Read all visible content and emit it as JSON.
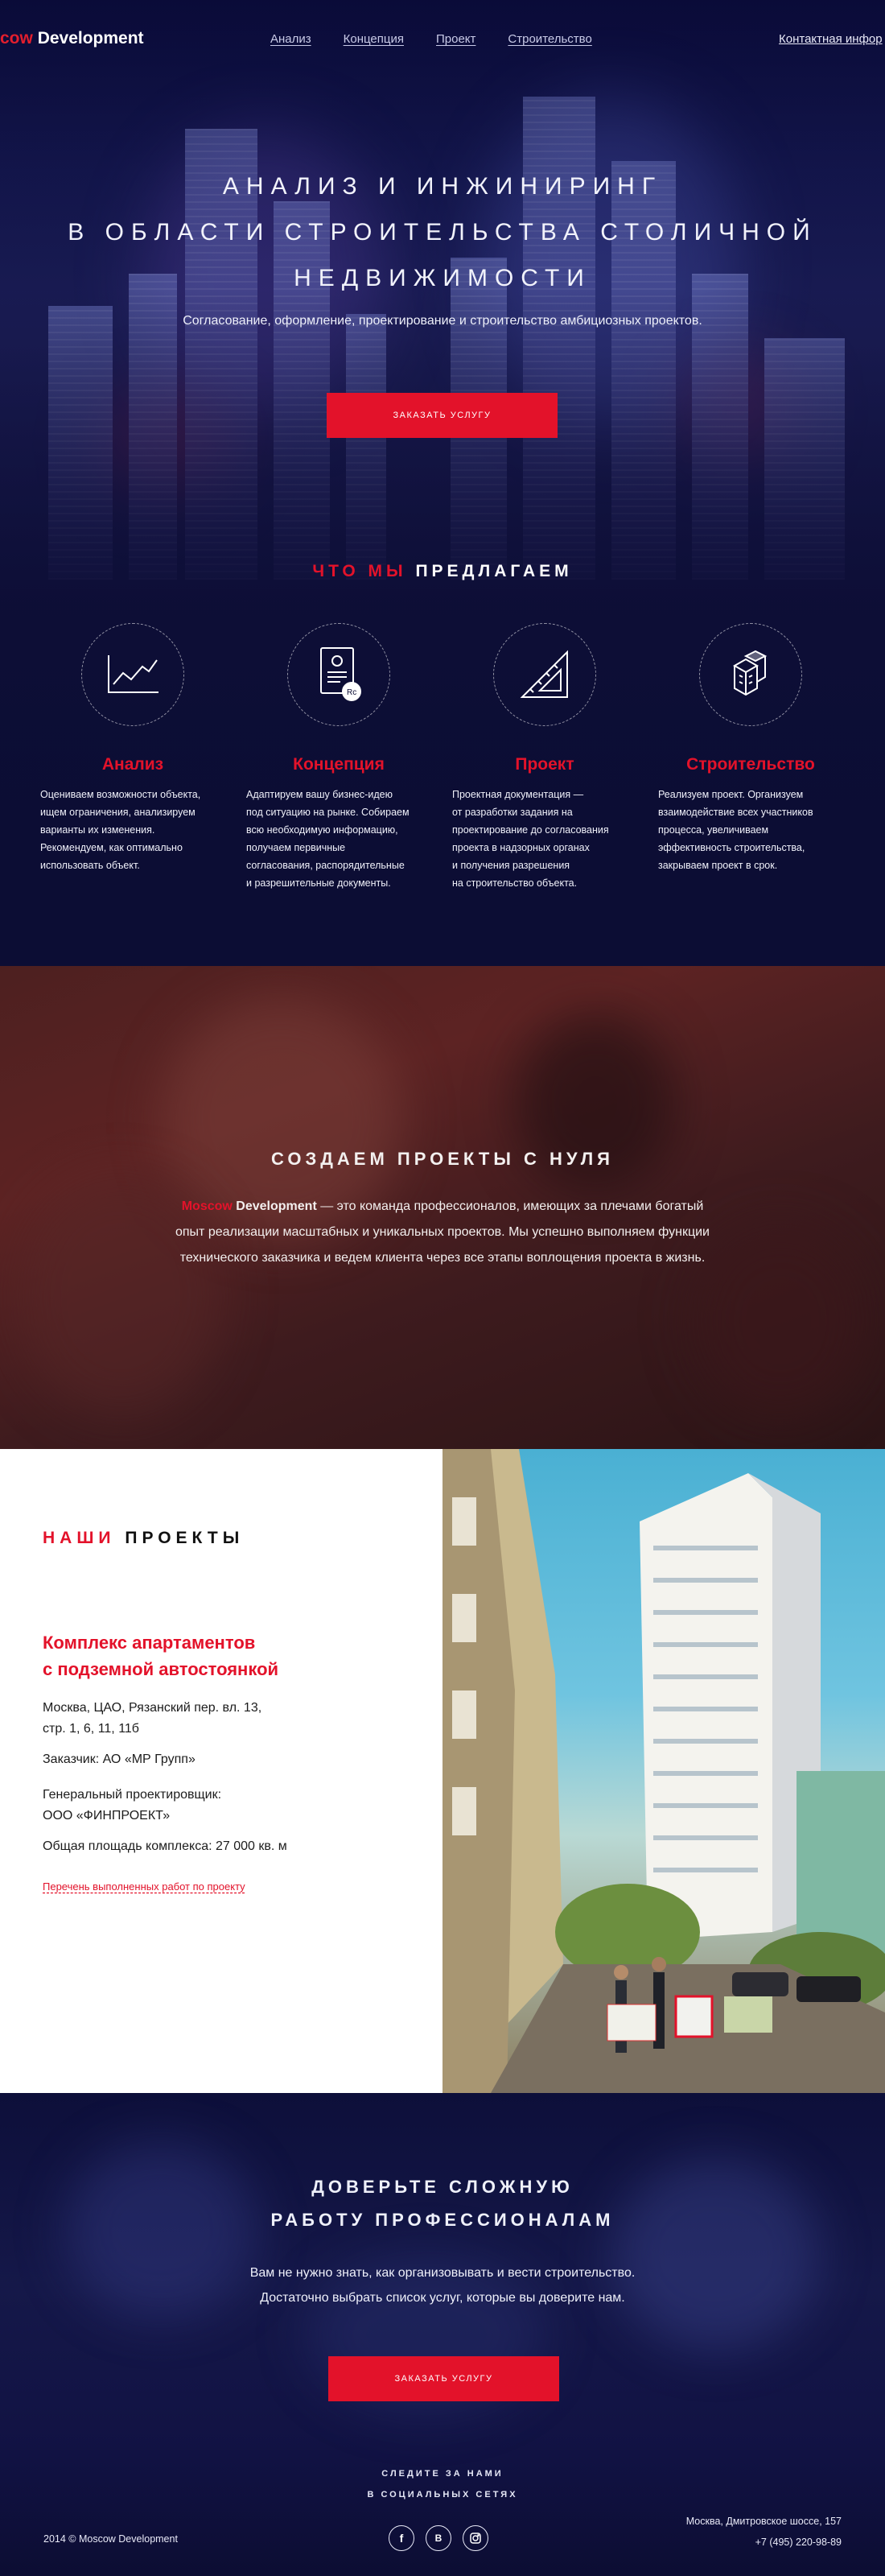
{
  "nav": {
    "logo_moscow": "cow",
    "logo_dev": "Development",
    "links": [
      "Анализ",
      "Концепция",
      "Проект",
      "Строительство"
    ],
    "contact": "Контактная инфор"
  },
  "hero": {
    "title_lines": [
      "Анализ и инжиниринг",
      "в области строительства столичной",
      "недвижимости"
    ],
    "subtitle": "Согласование, оформление, проектирование и строительство амбициозных проектов.",
    "cta": "ЗАКАЗАТЬ УСЛУГУ"
  },
  "offer": {
    "title_red": "ЧТО МЫ",
    "title_white": "ПРЕДЛАГАЕМ",
    "services": [
      {
        "icon": "chart-icon",
        "name": "Анализ",
        "lines": [
          "Оцениваем возможности объекта,",
          "ищем ограничения, анализируем",
          "варианты их изменения.",
          "Рекомендуем, как оптимально",
          "использовать объект."
        ]
      },
      {
        "icon": "certificate-icon",
        "name": "Концепция",
        "lines": [
          "Адаптируем вашу бизнес-идею",
          "под ситуацию на рынке. Собираем",
          "всю необходимую информацию,",
          "получаем первичные",
          "согласования, распорядительные",
          "и разрешительные документы."
        ]
      },
      {
        "icon": "ruler-triangle-icon",
        "name": "Проект",
        "lines": [
          "Проектная документация —",
          "от разработки задания на",
          "проектирование до согласования",
          "проекта в надзорных органах",
          "и получения разрешения",
          "на строительство объекта."
        ]
      },
      {
        "icon": "blocks-icon",
        "name": "Строительство",
        "lines": [
          "Реализуем проект. Организуем",
          "взаимодействие всех участников",
          "процесса, увеличиваем",
          "эффективность строительства,",
          "закрываем проект в срок."
        ]
      }
    ]
  },
  "team": {
    "title": "СОЗДАЕМ ПРОЕКТЫ С НУЛЯ",
    "brand_red": "Moscow",
    "brand_white": "Development",
    "text_line1": " — это команда профессионалов, имеющих за плечами богатый",
    "text_line2": "опыт реализации масштабных и уникальных проектов. Мы успешно выполняем функции",
    "text_line3": "технического заказчика и ведем клиента через все этапы воплощения проекта в жизнь."
  },
  "projects": {
    "heading_red": "НАШИ",
    "heading_black": "ПРОЕКТЫ",
    "name_lines": [
      "Комплекс апартаментов",
      "с подземной автостоянкой"
    ],
    "address_lines": [
      "Москва, ЦАО, Рязанский пер. вл. 13,",
      "стр. 1, 6, 11, 11б"
    ],
    "customer": "Заказчик: АО «МР Групп»",
    "designer_lines": [
      "Генеральный проектировщик:",
      "ООО «ФИНПРОЕКТ»"
    ],
    "area": "Общая площадь комплекса: 27 000 кв. м",
    "link": "Перечень  выполненных работ по проекту"
  },
  "trust": {
    "title_lines": [
      "ДОВЕРЬТЕ СЛОЖНУЮ",
      "РАБОТУ ПРОФЕССИОНАЛАМ"
    ],
    "text_lines": [
      "Вам не нужно знать, как организовывать и вести строительство.",
      "Достаточно выбрать список услуг, которые вы доверите нам."
    ],
    "cta": "ЗАКАЗАТЬ УСЛУГУ"
  },
  "footer": {
    "social_lines": [
      "СЛЕДИТЕ ЗА НАМИ",
      "В СОЦИАЛЬНЫХ СЕТЯХ"
    ],
    "socials": [
      {
        "icon": "facebook-icon",
        "glyph": "f"
      },
      {
        "icon": "vk-icon",
        "glyph": "B"
      },
      {
        "icon": "instagram-icon",
        "glyph": ""
      }
    ],
    "copyright": "2014 © Moscow Development",
    "address": "Москва, Дмитровское шоссе, 157",
    "phone": "+7 (495) 220-98-89"
  },
  "colors": {
    "accent": "#e3122a",
    "dark_bg": "#0c0d34",
    "team_bg": "#4d2020"
  }
}
